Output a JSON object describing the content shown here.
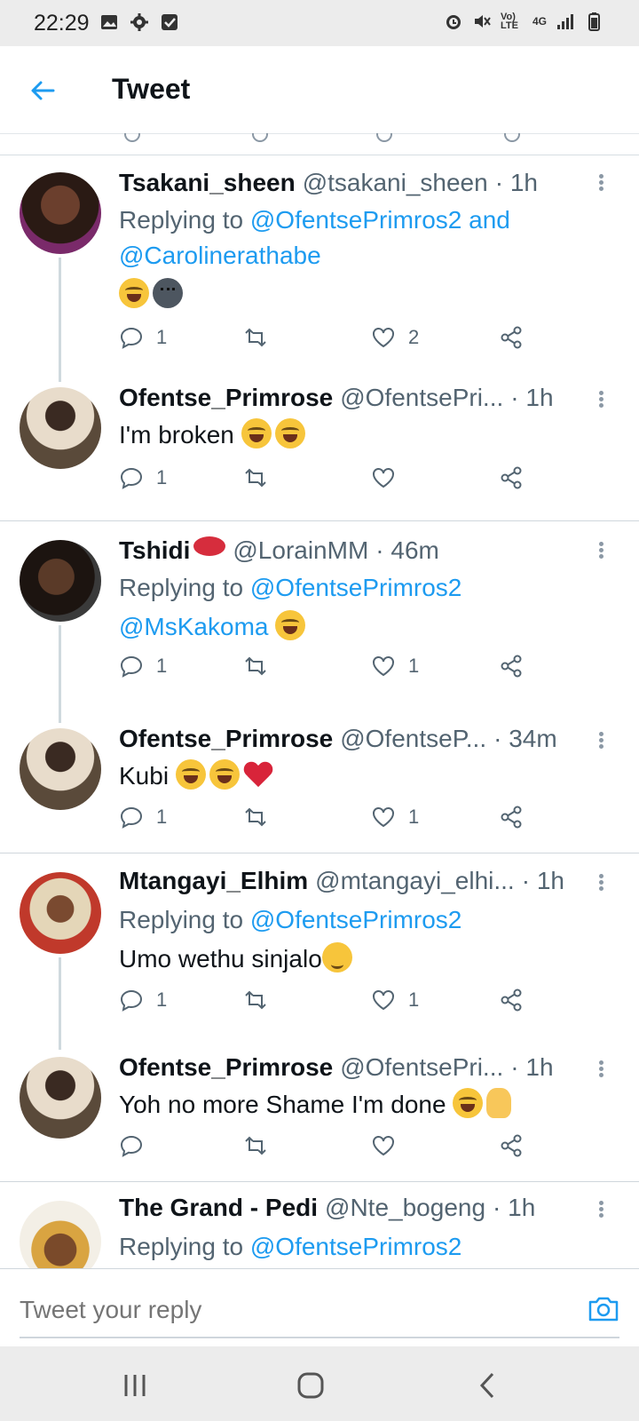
{
  "status_bar": {
    "time": "22:29",
    "network_label": "4G",
    "volte_label": "Vo) LTE"
  },
  "header": {
    "title": "Tweet"
  },
  "tweets": [
    {
      "name": "Tsakani_sheen",
      "handle": "@tsakani_sheen",
      "time": "· 1h",
      "replying_prefix": "Replying to",
      "replying_to": "@OfentsePrimros2 and",
      "replying_to_2": "@Carolinerathabe",
      "text": "",
      "reply_count": "1",
      "like_count": "2"
    },
    {
      "name": "Ofentse_Primrose",
      "handle": "@OfentsePri...",
      "time": "· 1h",
      "text": "I'm broken",
      "reply_count": "1",
      "like_count": ""
    },
    {
      "name": "Tshidi",
      "handle": "@LorainMM",
      "time": "· 46m",
      "replying_prefix": "Replying to",
      "replying_to": "@OfentsePrimros2",
      "text": "@MsKakoma",
      "reply_count": "1",
      "like_count": "1"
    },
    {
      "name": "Ofentse_Primrose",
      "handle": "@OfentseP...",
      "time": "· 34m",
      "text": "Kubi",
      "reply_count": "1",
      "like_count": "1"
    },
    {
      "name": "Mtangayi_Elhim",
      "handle": "@mtangayi_elhi...",
      "time": "· 1h",
      "replying_prefix": "Replying to",
      "replying_to": "@OfentsePrimros2",
      "text": "Umo wethu sinjalo",
      "reply_count": "1",
      "like_count": "1"
    },
    {
      "name": "Ofentse_Primrose",
      "handle": "@OfentsePri...",
      "time": "· 1h",
      "text": "Yoh no more Shame I'm done",
      "reply_count": "",
      "like_count": ""
    },
    {
      "name": "The Grand - Pedi",
      "handle": "@Nte_bogeng",
      "time": "· 1h",
      "replying_prefix": "Replying to",
      "replying_to": "@OfentsePrimros2",
      "text": ""
    }
  ],
  "composer": {
    "placeholder": "Tweet your reply"
  },
  "colors": {
    "accent": "#1d9bf0",
    "muted": "#536471",
    "divider": "#cfd6dc"
  },
  "icons": [
    "back-arrow-icon",
    "reply-icon",
    "retweet-icon",
    "like-icon",
    "share-icon",
    "more-icon",
    "camera-icon",
    "recents-icon",
    "home-icon",
    "back-icon"
  ]
}
